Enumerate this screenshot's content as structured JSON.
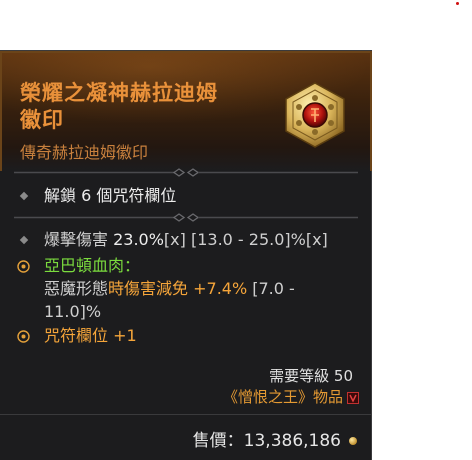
{
  "item": {
    "name_line1": "榮耀之凝神赫拉迪姆",
    "name_line2": "徽印",
    "type": "傳奇赫拉迪姆徽印"
  },
  "properties": {
    "unlock": "解鎖 6 個咒符欄位",
    "crit_label": "爆擊傷害 ",
    "crit_value": "23.0%",
    "crit_x": "[x]",
    "crit_range": " [13.0 - 25.0]%",
    "crit_range_x": "[x]"
  },
  "aspect": {
    "name": "亞巴頓血肉：",
    "desc_prefix": "惡魔形態",
    "desc_effect": "時傷害減免 +7.4%",
    "desc_range_line1": " [7.0 -",
    "desc_range_line2": "11.0]%"
  },
  "socket": {
    "label": "咒符欄位 +1"
  },
  "footer": {
    "required_level": "需要等級 50",
    "edition": "《憎恨之王》物品",
    "sell_value": "售價：13,386,186"
  },
  "colors": {
    "title": "#e9913a",
    "aspect_name": "#7bdc3e",
    "affix_highlight": "#f5a53a"
  },
  "icons": [
    "hexagonal-seal-icon",
    "bullet-diamond-icon",
    "legendary-aspect-icon",
    "expansion-badge-icon",
    "gold-coin-icon"
  ]
}
